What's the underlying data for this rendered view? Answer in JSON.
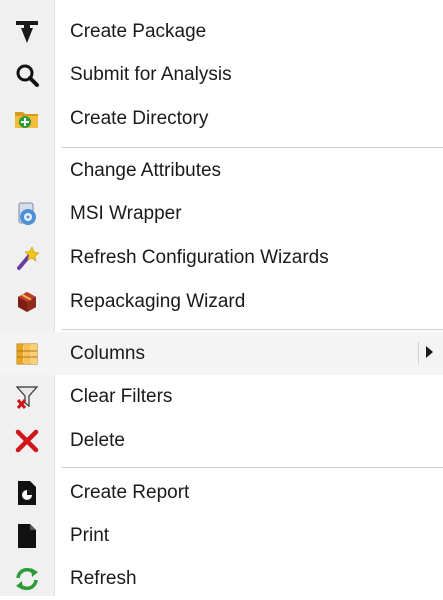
{
  "menu": {
    "items": [
      {
        "label": "Create Package",
        "icon": "create-package-icon"
      },
      {
        "label": "Submit for Analysis",
        "icon": "magnifier-icon"
      },
      {
        "label": "Create Directory",
        "icon": "folder-add-icon"
      },
      {
        "label": "Change Attributes",
        "icon": ""
      },
      {
        "label": "MSI Wrapper",
        "icon": "msi-wrapper-icon"
      },
      {
        "label": "Refresh Configuration Wizards",
        "icon": "magic-wand-icon"
      },
      {
        "label": "Repackaging Wizard",
        "icon": "package-box-icon"
      },
      {
        "label": "Columns",
        "icon": "columns-icon",
        "has_submenu": true
      },
      {
        "label": "Clear Filters",
        "icon": "clear-filter-icon"
      },
      {
        "label": "Delete",
        "icon": "delete-x-icon"
      },
      {
        "label": "Create Report",
        "icon": "report-icon"
      },
      {
        "label": "Print",
        "icon": "document-icon"
      },
      {
        "label": "Refresh",
        "icon": "refresh-arrows-icon"
      }
    ]
  },
  "colors": {
    "gutter": "#f0f0f0",
    "separator": "#cfcfcf",
    "delete_red": "#d0161b",
    "refresh_green": "#2e9b3a"
  }
}
